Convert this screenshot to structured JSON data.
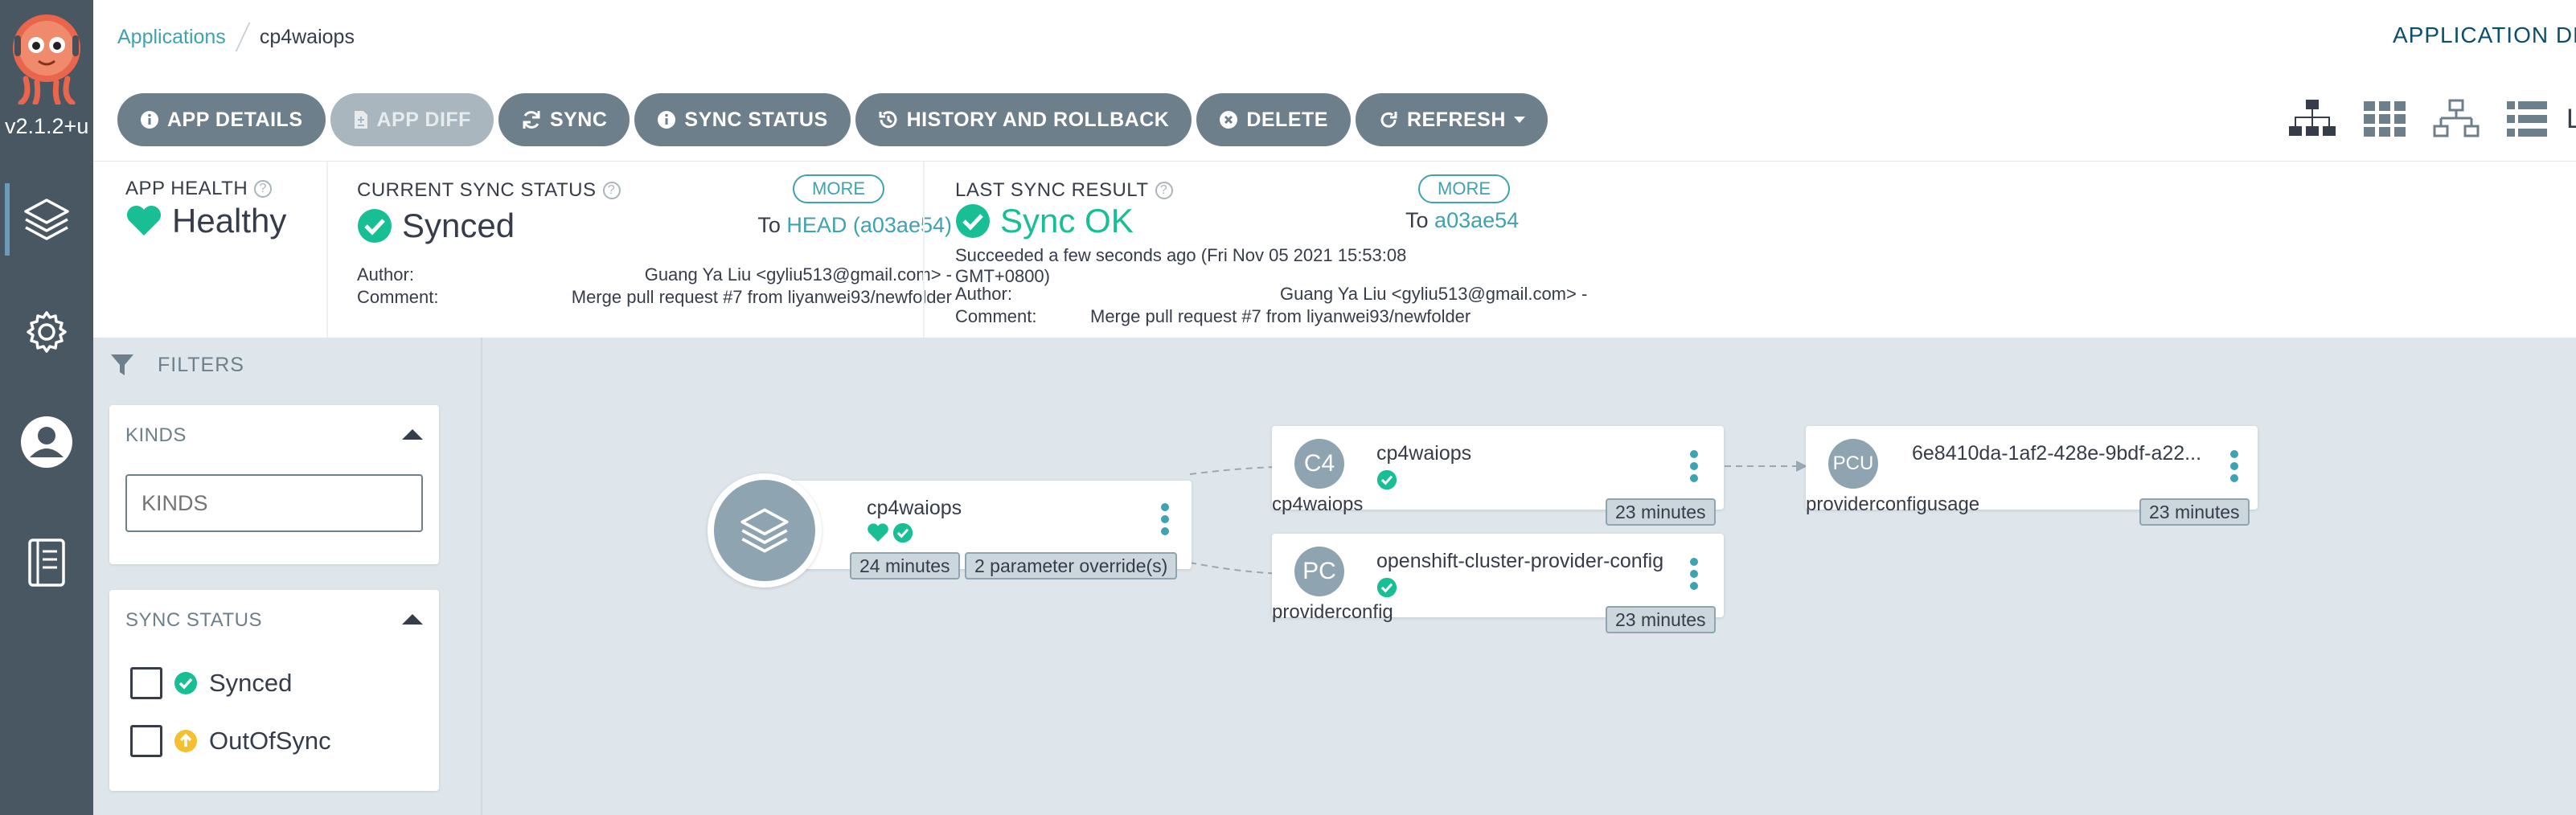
{
  "nav": {
    "version": "v2.1.2+u",
    "items": [
      "applications-icon",
      "settings-icon",
      "user-icon",
      "docs-icon"
    ]
  },
  "breadcrumb": {
    "root": "Applications",
    "current": "cp4waiops"
  },
  "header": {
    "right_title": "APPLICATION DE"
  },
  "toolbar": {
    "app_details": "APP DETAILS",
    "app_diff": "APP DIFF",
    "sync": "SYNC",
    "sync_status": "SYNC STATUS",
    "history": "HISTORY AND ROLLBACK",
    "delete": "DELETE",
    "refresh": "REFRESH"
  },
  "view_icons": {
    "lo": "Lo"
  },
  "status": {
    "app_health_label": "APP HEALTH",
    "app_health_value": "Healthy",
    "current_sync_label": "CURRENT SYNC STATUS",
    "current_sync_value": "Synced",
    "current_more": "MORE",
    "current_to_prefix": "To",
    "current_to_value": "HEAD (a03ae54)",
    "current_author_label": "Author:",
    "current_author_value": "Guang Ya Liu <gyliu513@gmail.com> -",
    "current_comment_label": "Comment:",
    "current_comment_value": "Merge pull request #7 from liyanwei93/newfolder",
    "last_sync_label": "LAST SYNC RESULT",
    "last_sync_value": "Sync OK",
    "last_more": "MORE",
    "last_to_prefix": "To",
    "last_to_value": "a03ae54",
    "last_succeeded": "Succeeded a few seconds ago (Fri Nov 05 2021 15:53:08",
    "last_succeeded_2": "GMT+0800)",
    "last_author_label": "Author:",
    "last_author_value": "Guang Ya Liu <gyliu513@gmail.com> -",
    "last_comment_label": "Comment:",
    "last_comment_value": "Merge pull request #7 from liyanwei93/newfolder"
  },
  "filters": {
    "title": "FILTERS",
    "kinds_title": "KINDS",
    "kinds_placeholder": "KINDS",
    "sync_title": "SYNC STATUS",
    "synced": "Synced",
    "outofsync": "OutOfSync"
  },
  "graph": {
    "app_node": {
      "name": "cp4waiops",
      "age": "24 minutes",
      "overrides": "2 parameter override(s)"
    },
    "node_c4": {
      "abbr": "C4",
      "name": "cp4waiops",
      "kind": "cp4waiops",
      "age": "23 minutes"
    },
    "node_pc": {
      "abbr": "PC",
      "name": "openshift-cluster-provider-config",
      "kind": "providerconfig",
      "age": "23 minutes"
    },
    "node_pcu": {
      "abbr": "PCU",
      "name": "6e8410da-1af2-428e-9bdf-a22...",
      "kind": "providerconfigusage",
      "age": "23 minutes"
    }
  },
  "colors": {
    "nav_bg": "#495763",
    "teal": "#3fa2b0",
    "healthy": "#18be94",
    "button": "#6d7f8b",
    "warning": "#f4c030"
  }
}
